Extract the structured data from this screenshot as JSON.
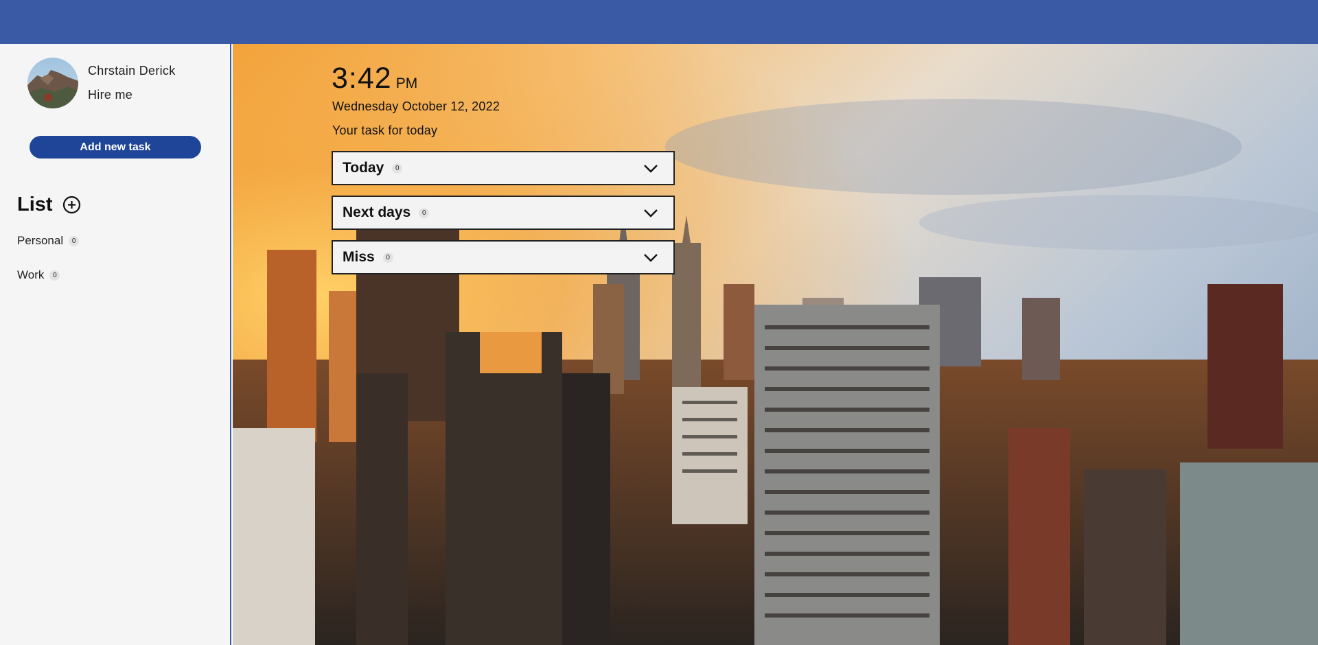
{
  "profile": {
    "name": "Chrstain Derick",
    "tagline": "Hire me",
    "avatar_icon": "avatar-photo"
  },
  "sidebar": {
    "add_task_label": "Add new task",
    "list_title": "List",
    "lists": [
      {
        "label": "Personal",
        "count": "0"
      },
      {
        "label": "Work",
        "count": "0"
      }
    ]
  },
  "main": {
    "time": "3:42",
    "ampm": "PM",
    "date": "Wednesday October 12, 2022",
    "subtitle": "Your task for today",
    "sections": [
      {
        "label": "Today",
        "count": "0"
      },
      {
        "label": "Next days",
        "count": "0"
      },
      {
        "label": "Miss",
        "count": "0"
      }
    ]
  },
  "colors": {
    "topbar": "#3b5aa5",
    "button": "#1f4598",
    "sidebar_bg": "#f5f5f5"
  }
}
